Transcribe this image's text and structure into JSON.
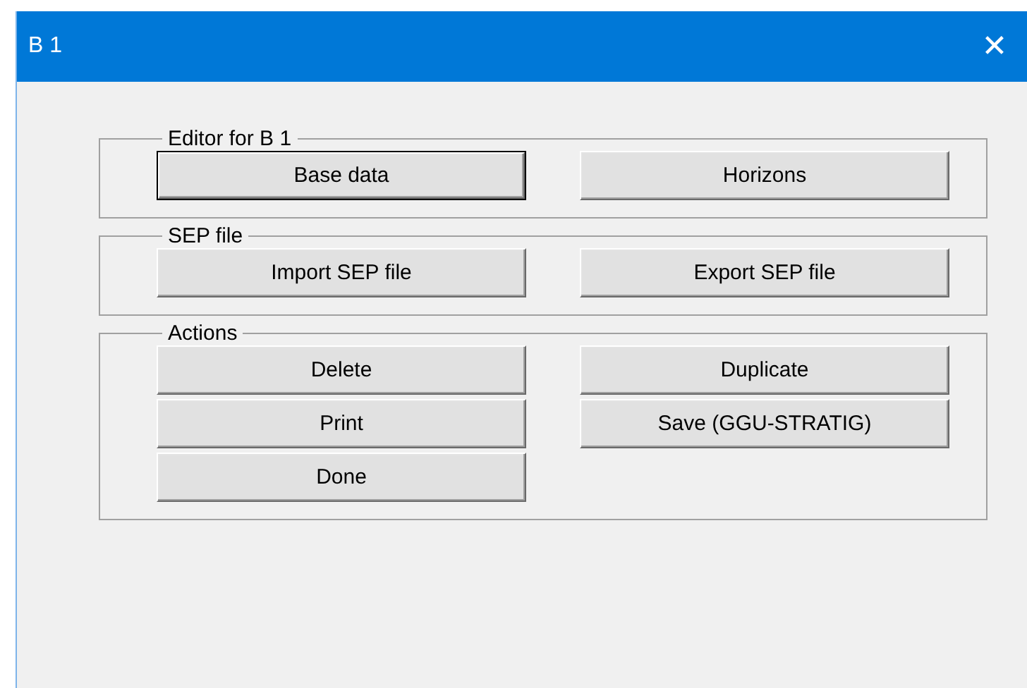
{
  "window": {
    "title": "B 1",
    "close": "✕"
  },
  "groups": [
    {
      "label": "Editor for B 1",
      "buttons": [
        {
          "label": "Base data",
          "default": true
        },
        {
          "label": "Horizons",
          "default": false
        }
      ]
    },
    {
      "label": "SEP file",
      "buttons": [
        {
          "label": "Import SEP file",
          "default": false
        },
        {
          "label": "Export SEP file",
          "default": false
        }
      ]
    },
    {
      "label": "Actions",
      "buttons": [
        {
          "label": "Delete",
          "default": false
        },
        {
          "label": "Duplicate",
          "default": false
        },
        {
          "label": "Print",
          "default": false
        },
        {
          "label": "Save (GGU-STRATIG)",
          "default": false
        },
        {
          "label": "Done",
          "default": false
        }
      ]
    }
  ]
}
